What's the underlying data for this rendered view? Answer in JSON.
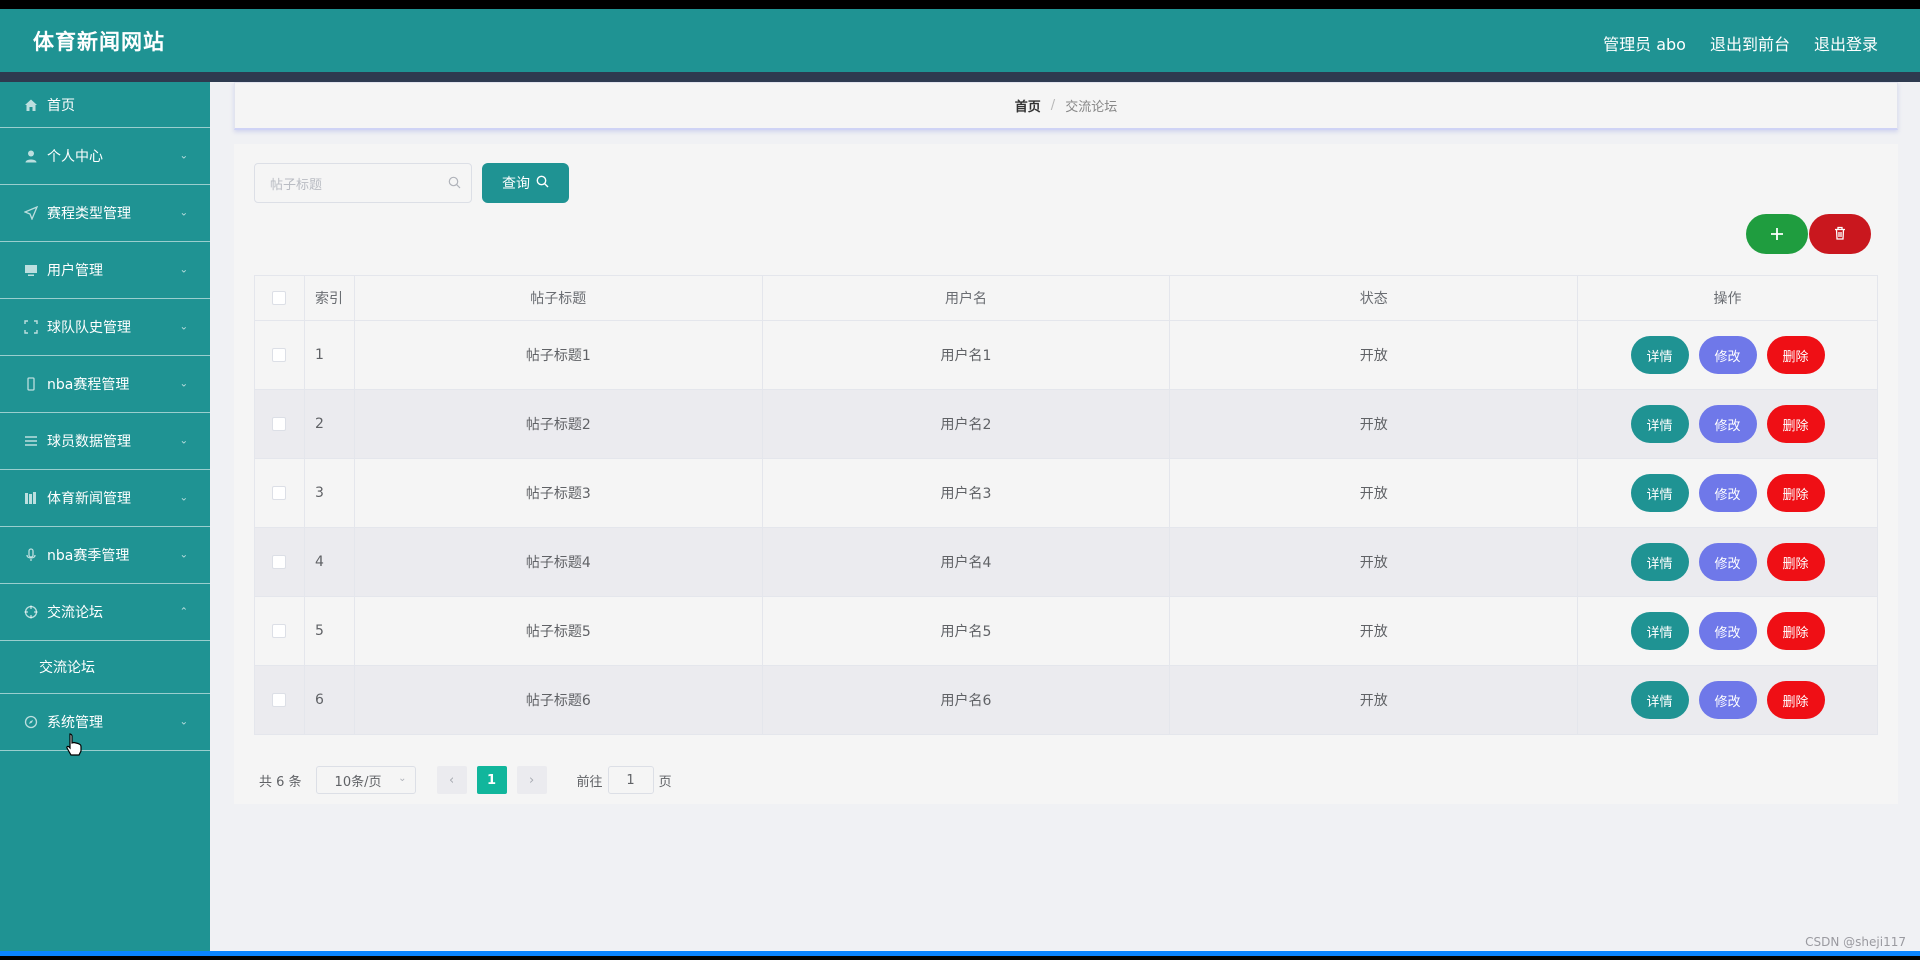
{
  "header": {
    "brand": "体育新闻网站",
    "links": [
      "管理员 abo",
      "退出到前台",
      "退出登录"
    ]
  },
  "sidebar": {
    "items": [
      {
        "label": "首页",
        "icon": "home-icon"
      },
      {
        "label": "个人中心",
        "icon": "user-icon"
      },
      {
        "label": "赛程类型管理",
        "icon": "send-icon"
      },
      {
        "label": "用户管理",
        "icon": "monitor-icon"
      },
      {
        "label": "球队队史管理",
        "icon": "fullscreen-icon"
      },
      {
        "label": "nba赛程管理",
        "icon": "phone-icon"
      },
      {
        "label": "球员数据管理",
        "icon": "list-icon"
      },
      {
        "label": "体育新闻管理",
        "icon": "books-icon"
      },
      {
        "label": "nba赛季管理",
        "icon": "microphone-icon"
      },
      {
        "label": "交流论坛",
        "icon": "crosshair-icon"
      },
      {
        "label": "系统管理",
        "icon": "compass-icon"
      }
    ],
    "sub_item": "交流论坛"
  },
  "breadcrumb": {
    "home": "首页",
    "sep": "/",
    "current": "交流论坛"
  },
  "search": {
    "placeholder": "帖子标题",
    "query_label": "查询"
  },
  "table": {
    "headers": [
      "索引",
      "帖子标题",
      "用户名",
      "状态",
      "操作"
    ],
    "rows": [
      {
        "index": "1",
        "title": "帖子标题1",
        "user": "用户名1",
        "status": "开放"
      },
      {
        "index": "2",
        "title": "帖子标题2",
        "user": "用户名2",
        "status": "开放"
      },
      {
        "index": "3",
        "title": "帖子标题3",
        "user": "用户名3",
        "status": "开放"
      },
      {
        "index": "4",
        "title": "帖子标题4",
        "user": "用户名4",
        "status": "开放"
      },
      {
        "index": "5",
        "title": "帖子标题5",
        "user": "用户名5",
        "status": "开放"
      },
      {
        "index": "6",
        "title": "帖子标题6",
        "user": "用户名6",
        "status": "开放"
      }
    ],
    "actions": {
      "detail": "详情",
      "edit": "修改",
      "delete": "删除"
    }
  },
  "pagination": {
    "total": "共 6 条",
    "page_size": "10条/页",
    "current_page": "1",
    "goto_prefix": "前往",
    "goto_value": "1",
    "goto_suffix": "页"
  },
  "watermark": "CSDN @sheji117",
  "colors": {
    "primary": "#1f9393",
    "header_dark": "#2e3a4f",
    "add": "#1f9d3f",
    "delete_batch": "#c9171e",
    "edit": "#6f78e9",
    "delete": "#ef0f15",
    "page_active": "#11b69c"
  }
}
